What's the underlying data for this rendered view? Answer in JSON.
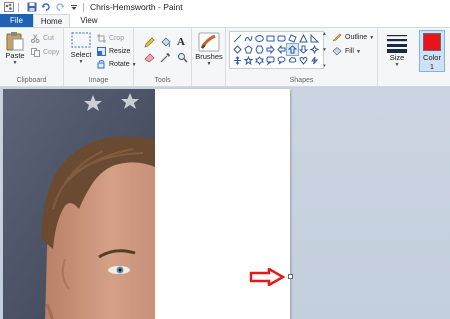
{
  "window": {
    "title": "Chris-Hemsworth - Paint"
  },
  "tabs": {
    "file": "File",
    "home": "Home",
    "view": "View"
  },
  "ribbon": {
    "clipboard": {
      "group": "Clipboard",
      "paste": "Paste",
      "cut": "Cut",
      "copy": "Copy"
    },
    "image": {
      "group": "Image",
      "select": "Select",
      "crop": "Crop",
      "resize": "Resize",
      "rotate": "Rotate"
    },
    "tools": {
      "group": "Tools"
    },
    "brushes": {
      "label": "Brushes"
    },
    "shapes": {
      "group": "Shapes",
      "outline": "Outline",
      "fill": "Fill"
    },
    "size": {
      "label": "Size"
    },
    "color1": {
      "label": "Color",
      "number": "1",
      "value": "#e8141b"
    }
  },
  "colors": {
    "file_tab": "#1e62b3",
    "arrow": "#e21a1a"
  }
}
